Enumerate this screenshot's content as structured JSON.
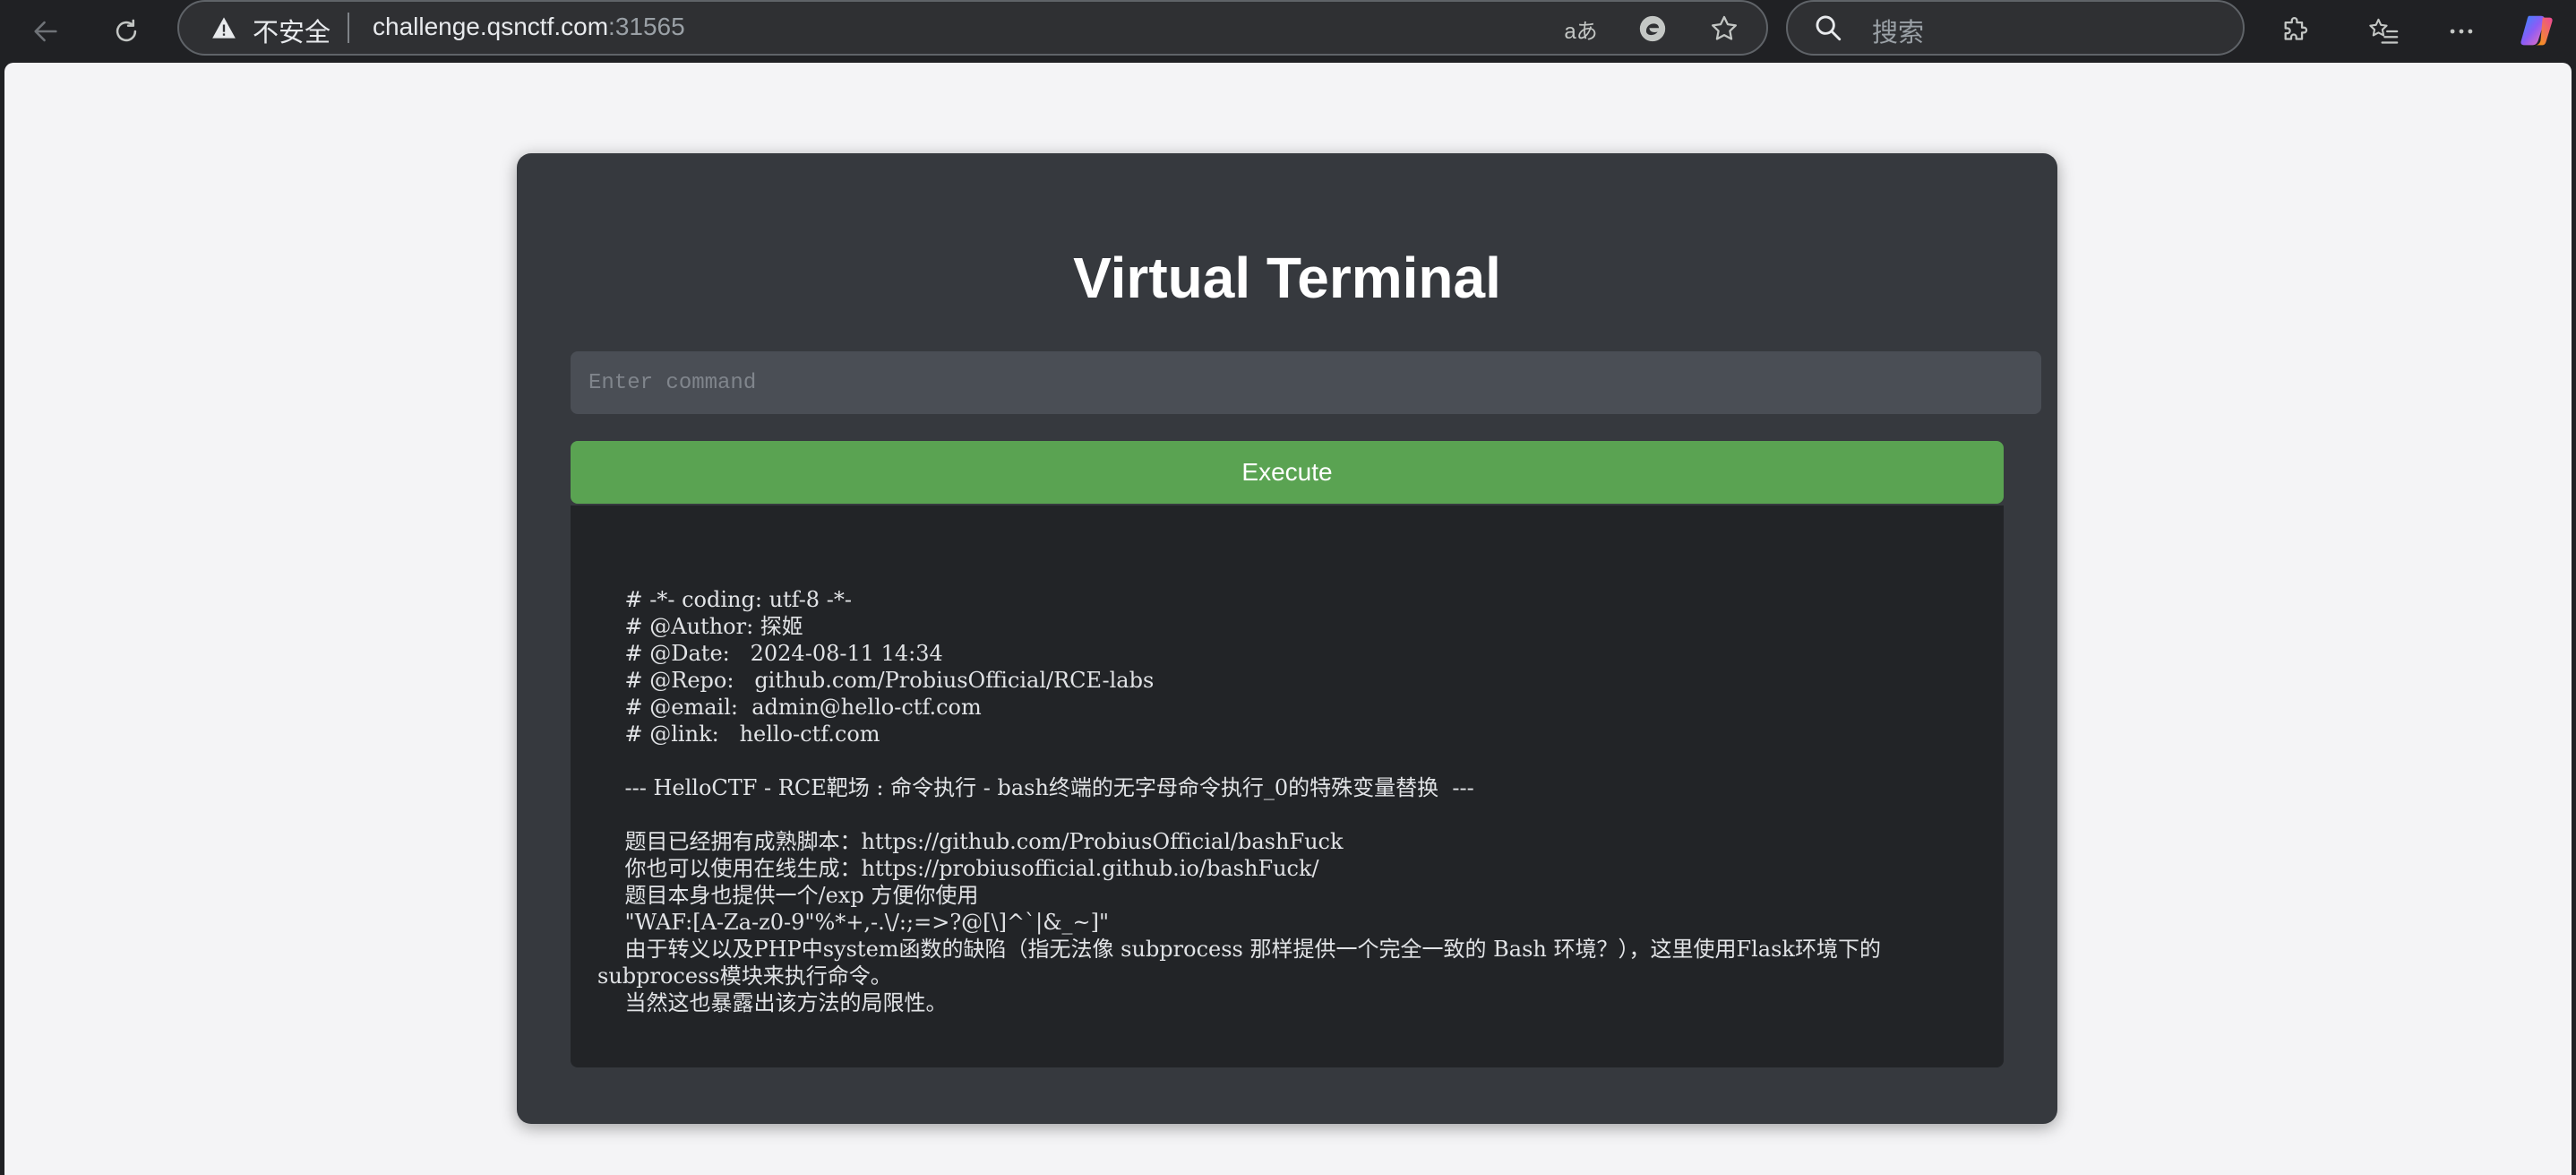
{
  "browser": {
    "security_label": "不安全",
    "url_host": "challenge.qsnctf.com",
    "url_port": ":31565",
    "search_placeholder": "搜索",
    "translate_glyph": "aあ"
  },
  "page": {
    "title": "Virtual Terminal",
    "command_placeholder": "Enter command",
    "execute_label": "Execute",
    "output_text": "    # -*- coding: utf-8 -*-\n    # @Author: 探姬\n    # @Date:   2024-08-11 14:34\n    # @Repo:   github.com/ProbiusOfficial/RCE-labs\n    # @email:  admin@hello-ctf.com\n    # @link:   hello-ctf.com\n\n    --- HelloCTF - RCE靶场 : 命令执行 - bash终端的无字母命令执行_0的特殊变量替换  ---\n\n    题目已经拥有成熟脚本：https://github.com/ProbiusOfficial/bashFuck\n    你也可以使用在线生成：https://probiusofficial.github.io/bashFuck/\n    题目本身也提供一个/exp 方便你使用\n    \"WAF:[A-Za-z0-9\"%*+,-.\\/:;=>?@[\\]^`|&_~]\"\n    由于转义以及PHP中system函数的缺陷（指无法像 subprocess 那样提供一个完全一致的 Bash 环境？），这里使用Flask环境下的\nsubprocess模块来执行命令。\n    当然这也暴露出该方法的局限性。"
  }
}
